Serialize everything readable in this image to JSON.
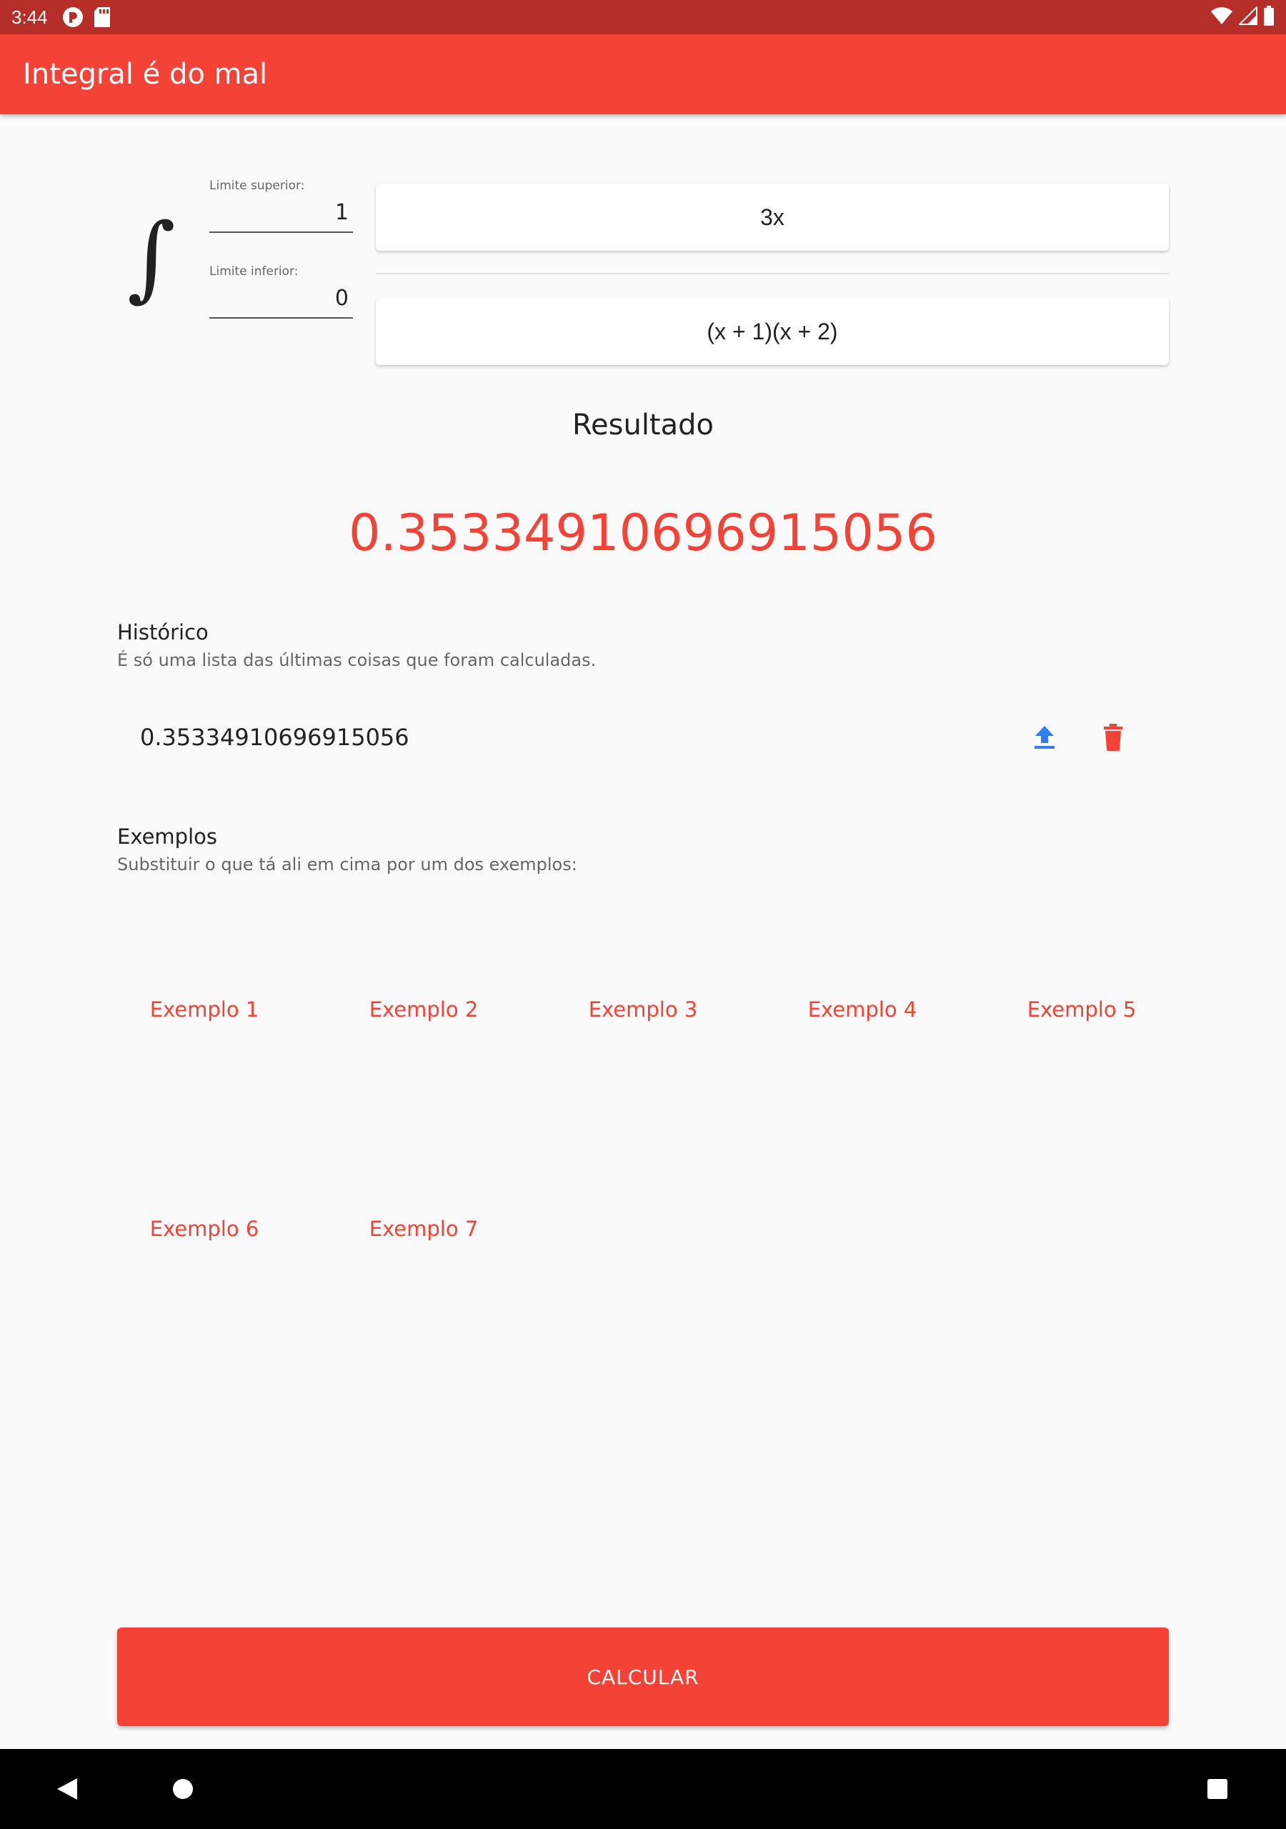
{
  "status_bar": {
    "time": "3:44",
    "icons": [
      "notification-app-icon",
      "sd-card-icon",
      "wifi-icon",
      "signal-icon",
      "battery-icon"
    ]
  },
  "app_bar": {
    "title": "Integral é do mal"
  },
  "integral": {
    "symbol": "∫",
    "upper_limit": {
      "label": "Limite superior:",
      "value": "1"
    },
    "lower_limit": {
      "label": "Limite inferior:",
      "value": "0"
    },
    "numerator": "3x",
    "denominator": "(x + 1)(x + 2)"
  },
  "result": {
    "heading": "Resultado",
    "value": "0.35334910696915056"
  },
  "history": {
    "title": "Histórico",
    "subtitle": "É só uma lista das últimas coisas que foram calculadas.",
    "items": [
      {
        "value": "0.35334910696915056"
      }
    ]
  },
  "examples": {
    "title": "Exemplos",
    "subtitle": "Substituir o que tá ali em cima por um dos exemplos:",
    "items": [
      "Exemplo 1",
      "Exemplo 2",
      "Exemplo 3",
      "Exemplo 4",
      "Exemplo 5",
      "Exemplo 6",
      "Exemplo 7"
    ]
  },
  "calculate_button": "CALCULAR",
  "colors": {
    "primary": "#f44336",
    "status_bar": "#b52f28",
    "upload_icon": "#2f7ff0",
    "background": "#fafafa"
  }
}
